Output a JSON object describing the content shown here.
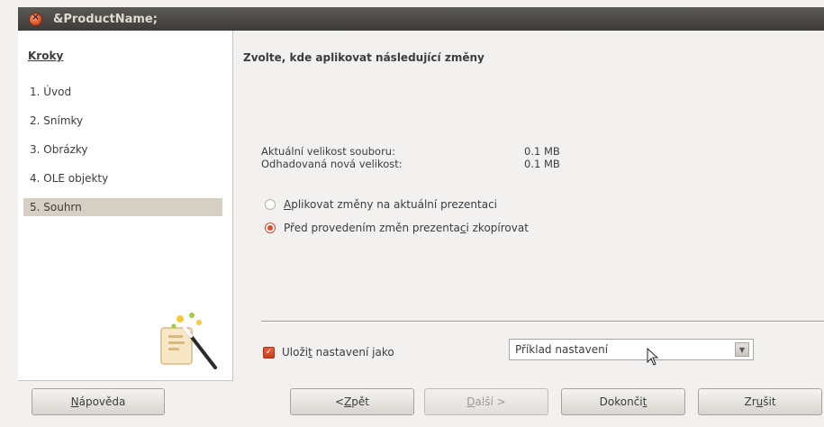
{
  "window": {
    "title": "&ProductName;"
  },
  "sidebar": {
    "title": "Kroky",
    "steps": [
      {
        "label": "1. Úvod"
      },
      {
        "label": "2. Snímky"
      },
      {
        "label": "3. Obrázky"
      },
      {
        "label": "4. OLE objekty"
      },
      {
        "label": "5. Souhrn",
        "active": true
      }
    ]
  },
  "main": {
    "heading": "Zvolte, kde aplikovat následující změny",
    "current_size_label": "Aktuální velikost souboru:",
    "current_size_value": "0.1 MB",
    "estimated_size_label": "Odhadovaná nová velikost:",
    "estimated_size_value": "0.1 MB",
    "radio_apply": {
      "label_pre": "",
      "mnemonic": "A",
      "label_post": "plikovat změny na aktuální prezentaci",
      "checked": false
    },
    "radio_copy": {
      "label_pre": "Před provedením změn prezenta",
      "mnemonic": "c",
      "label_post": "i zkopírovat",
      "checked": true
    },
    "save_settings": {
      "label_pre": "Uloži",
      "mnemonic": "t",
      "label_post": " nastavení jako",
      "checked": true
    },
    "settings_select": {
      "value": "Příklad nastavení"
    }
  },
  "buttons": {
    "help": {
      "pre": "",
      "mn": "N",
      "post": "ápověda"
    },
    "back": {
      "pre": "< ",
      "mn": "Z",
      "post": "pět"
    },
    "next": {
      "pre": "",
      "mn": "D",
      "post": "alší >"
    },
    "finish": {
      "pre": "Dokonči",
      "mn": "t",
      "post": ""
    },
    "cancel": {
      "pre": "Zr",
      "mn": "u",
      "post": "šit"
    }
  },
  "colors": {
    "accent": "#dd4b2a",
    "titlebar": "#3c3b37",
    "selection": "#d6cfc3"
  }
}
